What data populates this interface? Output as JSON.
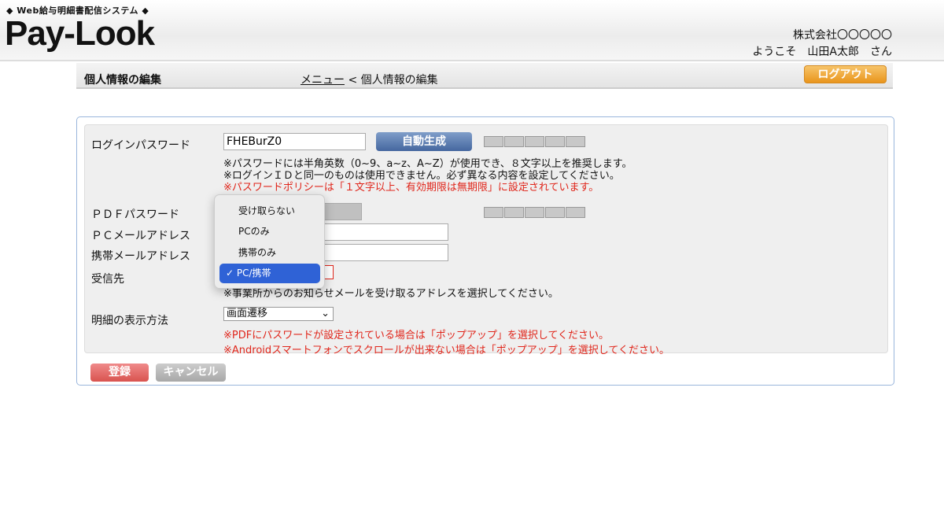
{
  "header": {
    "logo_sub": "◆ Web給与明細書配信システム ◆",
    "logo": "Pay-Look",
    "company": "株式会社〇〇〇〇〇",
    "welcome": "ようこそ　山田A太郎　さん"
  },
  "titlebar": {
    "title": "個人情報の編集",
    "breadcrumb_menu": "メニュー",
    "breadcrumb_sep": "<",
    "breadcrumb_current": "個人情報の編集",
    "logout": "ログアウト"
  },
  "form": {
    "login_password_label": "ログインパスワード",
    "login_password_value": "FHEBurZ0",
    "autogen": "自動生成",
    "note1": "※パスワードには半角英数（0~9、a~z、A~Z）が使用でき、８文字以上を推奨します。",
    "note2": "※ログインＩＤと同一のものは使用できません。必ず異なる内容を設定してください。",
    "note3": "※パスワードポリシーは「１文字以上、有効期限は無期限」に設定されています。",
    "pdf_password_label": "ＰＤＦパスワード",
    "pc_mail_label": "ＰＣメールアドレス",
    "mobile_mail_label": "携帯メールアドレス",
    "recipient_label": "受信先",
    "recipient_note": "※事業所からのお知らせメールを受け取るアドレスを選択してください。",
    "display_label": "明細の表示方法",
    "display_value": "画面遷移",
    "display_note1": "※PDFにパスワードが設定されている場合は「ポップアップ」を選択してください。",
    "display_note2": "※Androidスマートフォンでスクロールが出来ない場合は「ポップアップ」を選択してください。",
    "submit": "登録",
    "cancel": "キャンセル"
  },
  "dropdown": {
    "options": [
      "受け取らない",
      "PCのみ",
      "携帯のみ",
      "PC/携帯"
    ],
    "selected": "PC/携帯",
    "check": "✓"
  }
}
